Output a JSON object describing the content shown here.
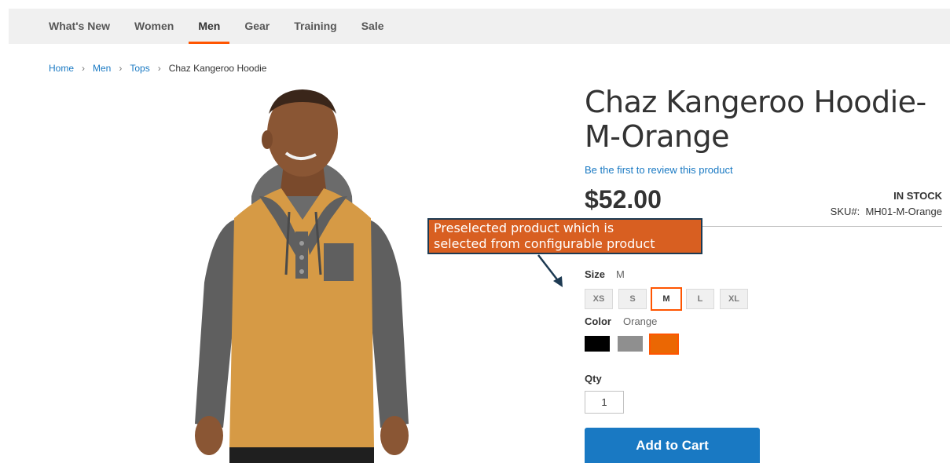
{
  "nav": {
    "items": [
      "What's New",
      "Women",
      "Men",
      "Gear",
      "Training",
      "Sale"
    ],
    "active": "Men"
  },
  "breadcrumbs": {
    "items": [
      "Home",
      "Men",
      "Tops"
    ],
    "current": "Chaz Kangeroo Hoodie",
    "separator": "›"
  },
  "product": {
    "title": "Chaz Kangeroo Hoodie-M-Orange",
    "review_link": "Be the first to review this product",
    "price": "$52.00",
    "stock": "IN STOCK",
    "sku_label": "SKU#:",
    "sku": "MH01-M-Orange"
  },
  "options": {
    "size_label": "Size",
    "size_selected": "M",
    "sizes": [
      "XS",
      "S",
      "M",
      "L",
      "XL"
    ],
    "color_label": "Color",
    "color_selected": "Orange",
    "colors": [
      {
        "name": "Black",
        "hex": "#000000"
      },
      {
        "name": "Gray",
        "hex": "#8f8f8f"
      },
      {
        "name": "Orange",
        "hex": "#eb6703"
      }
    ]
  },
  "qty": {
    "label": "Qty",
    "value": "1"
  },
  "cart": {
    "button_label": "Add to Cart"
  },
  "annotation": {
    "text_line1": "Preselected product which is",
    "text_line2": "selected from configurable product"
  },
  "colors": {
    "accent": "#ff5501",
    "link": "#1979c3",
    "callout_bg": "#d85f21",
    "callout_border": "#1d3a52"
  }
}
